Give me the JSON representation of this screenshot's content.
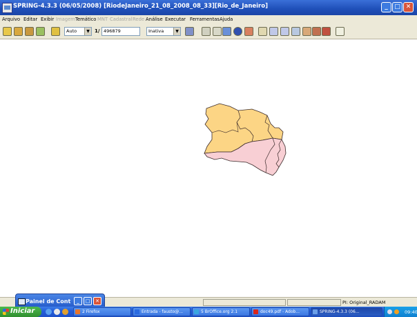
{
  "window": {
    "title": "SPRING-4.3.3 (06/05/2008)  [RiodeJaneiro_21_08_2008_08_33][Rio_de_Janeiro]",
    "minimize": "_",
    "maximize": "□",
    "close": "✕"
  },
  "menu": {
    "items": [
      {
        "label": "Arquivo",
        "enabled": true
      },
      {
        "label": "Editar",
        "enabled": true
      },
      {
        "label": "Exibir",
        "enabled": true
      },
      {
        "label": "Imagem",
        "enabled": false
      },
      {
        "label": "Temático",
        "enabled": true
      },
      {
        "label": "MNT",
        "enabled": false
      },
      {
        "label": "Cadastral",
        "enabled": false
      },
      {
        "label": "Rede",
        "enabled": false
      },
      {
        "label": "Análise",
        "enabled": true
      },
      {
        "label": "Executar",
        "enabled": true
      },
      {
        "label": "Ferramentas",
        "enabled": true
      },
      {
        "label": "Ajuda",
        "enabled": true
      }
    ]
  },
  "toolbar": {
    "zoom_mode": "Auto",
    "scale_prefix": "1/",
    "scale_value": "496879",
    "state_select": "Inativa",
    "icons": [
      "database-icon",
      "project-icon",
      "category-icon",
      "plane-icon",
      "display-icon",
      "panel-icon",
      "view-toggle-icon",
      "cursor-cross-icon",
      "pan-icon",
      "info-icon",
      "pencil-erase-icon",
      "draw-line-icon",
      "measure-icon",
      "edit-icon",
      "rotate-icon",
      "pencil-icon",
      "arrows-icon",
      "hand-icon",
      "help-icon"
    ]
  },
  "status": {
    "pi_label": "PI: Original_RADAM"
  },
  "minimized_window": {
    "title": "Painel de Cont",
    "minimize": "_",
    "maximize": "□",
    "close": "✕"
  },
  "taskbar": {
    "start_label": "Iniciar",
    "buttons": [
      {
        "label": "2 Firefox",
        "icon": "firefox-icon",
        "color": "#e8752a"
      },
      {
        "label": "Entrada - fausto@...",
        "icon": "mail-icon",
        "color": "#2a6ae0"
      },
      {
        "label": "5 BrOffice.org 2.1",
        "icon": "office-icon",
        "color": "#3aa6e0"
      },
      {
        "label": "doc49.pdf - Adob...",
        "icon": "pdf-icon",
        "color": "#d9261c"
      },
      {
        "label": "SPRING-4.3.3 (06...",
        "icon": "spring-icon",
        "color": "#6a9ee8"
      }
    ],
    "clock": "09:40"
  },
  "map": {
    "region_colors": {
      "north": "#fcd585",
      "south": "#f8cfd4",
      "outline": "#3a2a2a"
    }
  }
}
